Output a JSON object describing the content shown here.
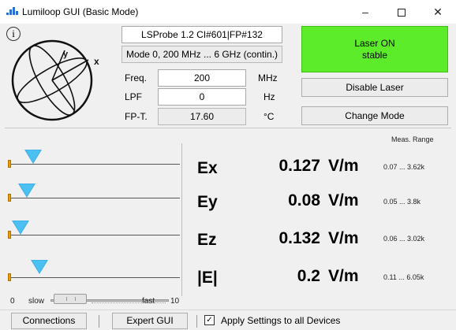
{
  "window": {
    "title": "Lumiloop GUI (Basic Mode)",
    "minimize": "–",
    "close": "✕"
  },
  "info": {
    "symbol": "i"
  },
  "probe": {
    "id": "LSProbe 1.2 CI#601|FP#132",
    "mode": "Mode 0, 200 MHz ... 6 GHz (contin.)",
    "axis_labels": {
      "x": "x",
      "y": "y"
    }
  },
  "settings": {
    "freq": {
      "label": "Freq.",
      "value": "200",
      "unit": "MHz"
    },
    "lpf": {
      "label": "LPF",
      "value": "0",
      "unit": "Hz"
    },
    "fpt": {
      "label": "FP-T.",
      "value": "17.60",
      "unit": "°C"
    }
  },
  "laser": {
    "status_line1": "Laser ON",
    "status_line2": "stable",
    "status_color": "#5cec2a",
    "disable_label": "Disable Laser",
    "change_mode_label": "Change Mode"
  },
  "measurements": {
    "range_header": "Meas. Range",
    "rows": [
      {
        "name": "Ex",
        "value": "0.127",
        "unit": "V/m",
        "range": "0.07 ... 3.62k"
      },
      {
        "name": "Ey",
        "value": "0.08",
        "unit": "V/m",
        "range": "0.05 ... 3.8k"
      },
      {
        "name": "Ez",
        "value": "0.132",
        "unit": "V/m",
        "range": "0.06 ... 3.02k"
      },
      {
        "name": "|E|",
        "value": "0.2",
        "unit": "V/m",
        "range": "0.11 ... 6.05k"
      }
    ]
  },
  "speed": {
    "min": "0",
    "slow": "slow",
    "fast": "fast",
    "max": "10"
  },
  "bottom": {
    "connections_label": "Connections",
    "expert_label": "Expert GUI",
    "apply_checked": true,
    "checkmark": "✓",
    "apply_label": "Apply Settings to all Devices"
  }
}
